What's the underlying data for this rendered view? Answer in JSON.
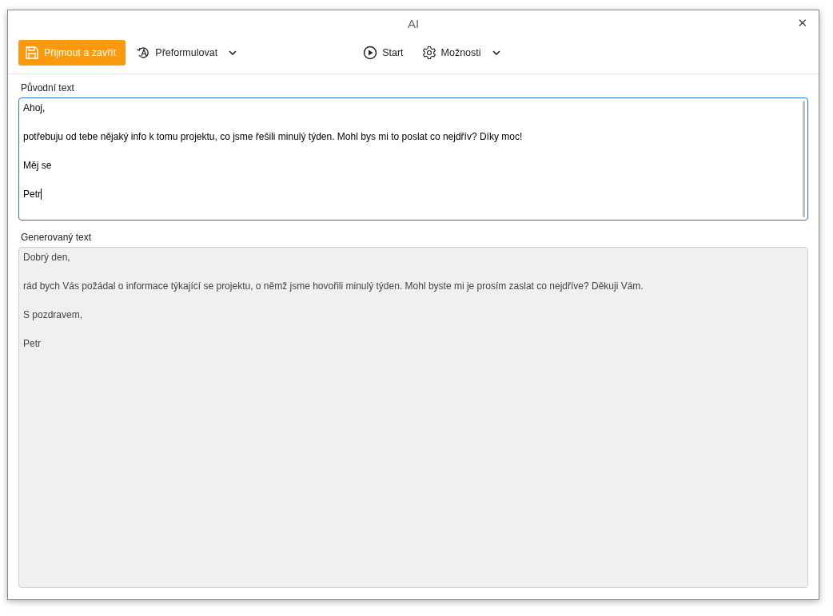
{
  "window": {
    "title": "AI",
    "close": "✕"
  },
  "toolbar": [
    {
      "kind": "primary",
      "label": "Přijmout a zavřít",
      "dropdown": false
    },
    {
      "kind": "plain",
      "label": "Přeformulovat",
      "dropdown": true
    },
    {
      "kind": "plain",
      "label": "Start",
      "dropdown": false
    },
    {
      "kind": "plain",
      "label": "Možnosti",
      "dropdown": true
    }
  ],
  "original_text": {
    "label": "Původní text",
    "focused": true,
    "readonly": false,
    "lines": [
      "Ahoj,",
      "potřebuju od tebe nějaký info k tomu projektu, co jsme řešili minulý týden. Mohl bys mi to poslat co nejdřív? Díky moc!",
      "Měj se",
      "Petr"
    ]
  },
  "generated_text": {
    "label": "Generovaný text",
    "focused": false,
    "readonly": true,
    "lines": [
      "Dobrý den,",
      "rád bych Vás požádal o informace týkající se projektu, o němž jsme hovořili minulý týden. Mohl byste mi je prosím zaslat co nejdříve? Děkuji Vám.",
      "S pozdravem,",
      "Petr"
    ]
  }
}
